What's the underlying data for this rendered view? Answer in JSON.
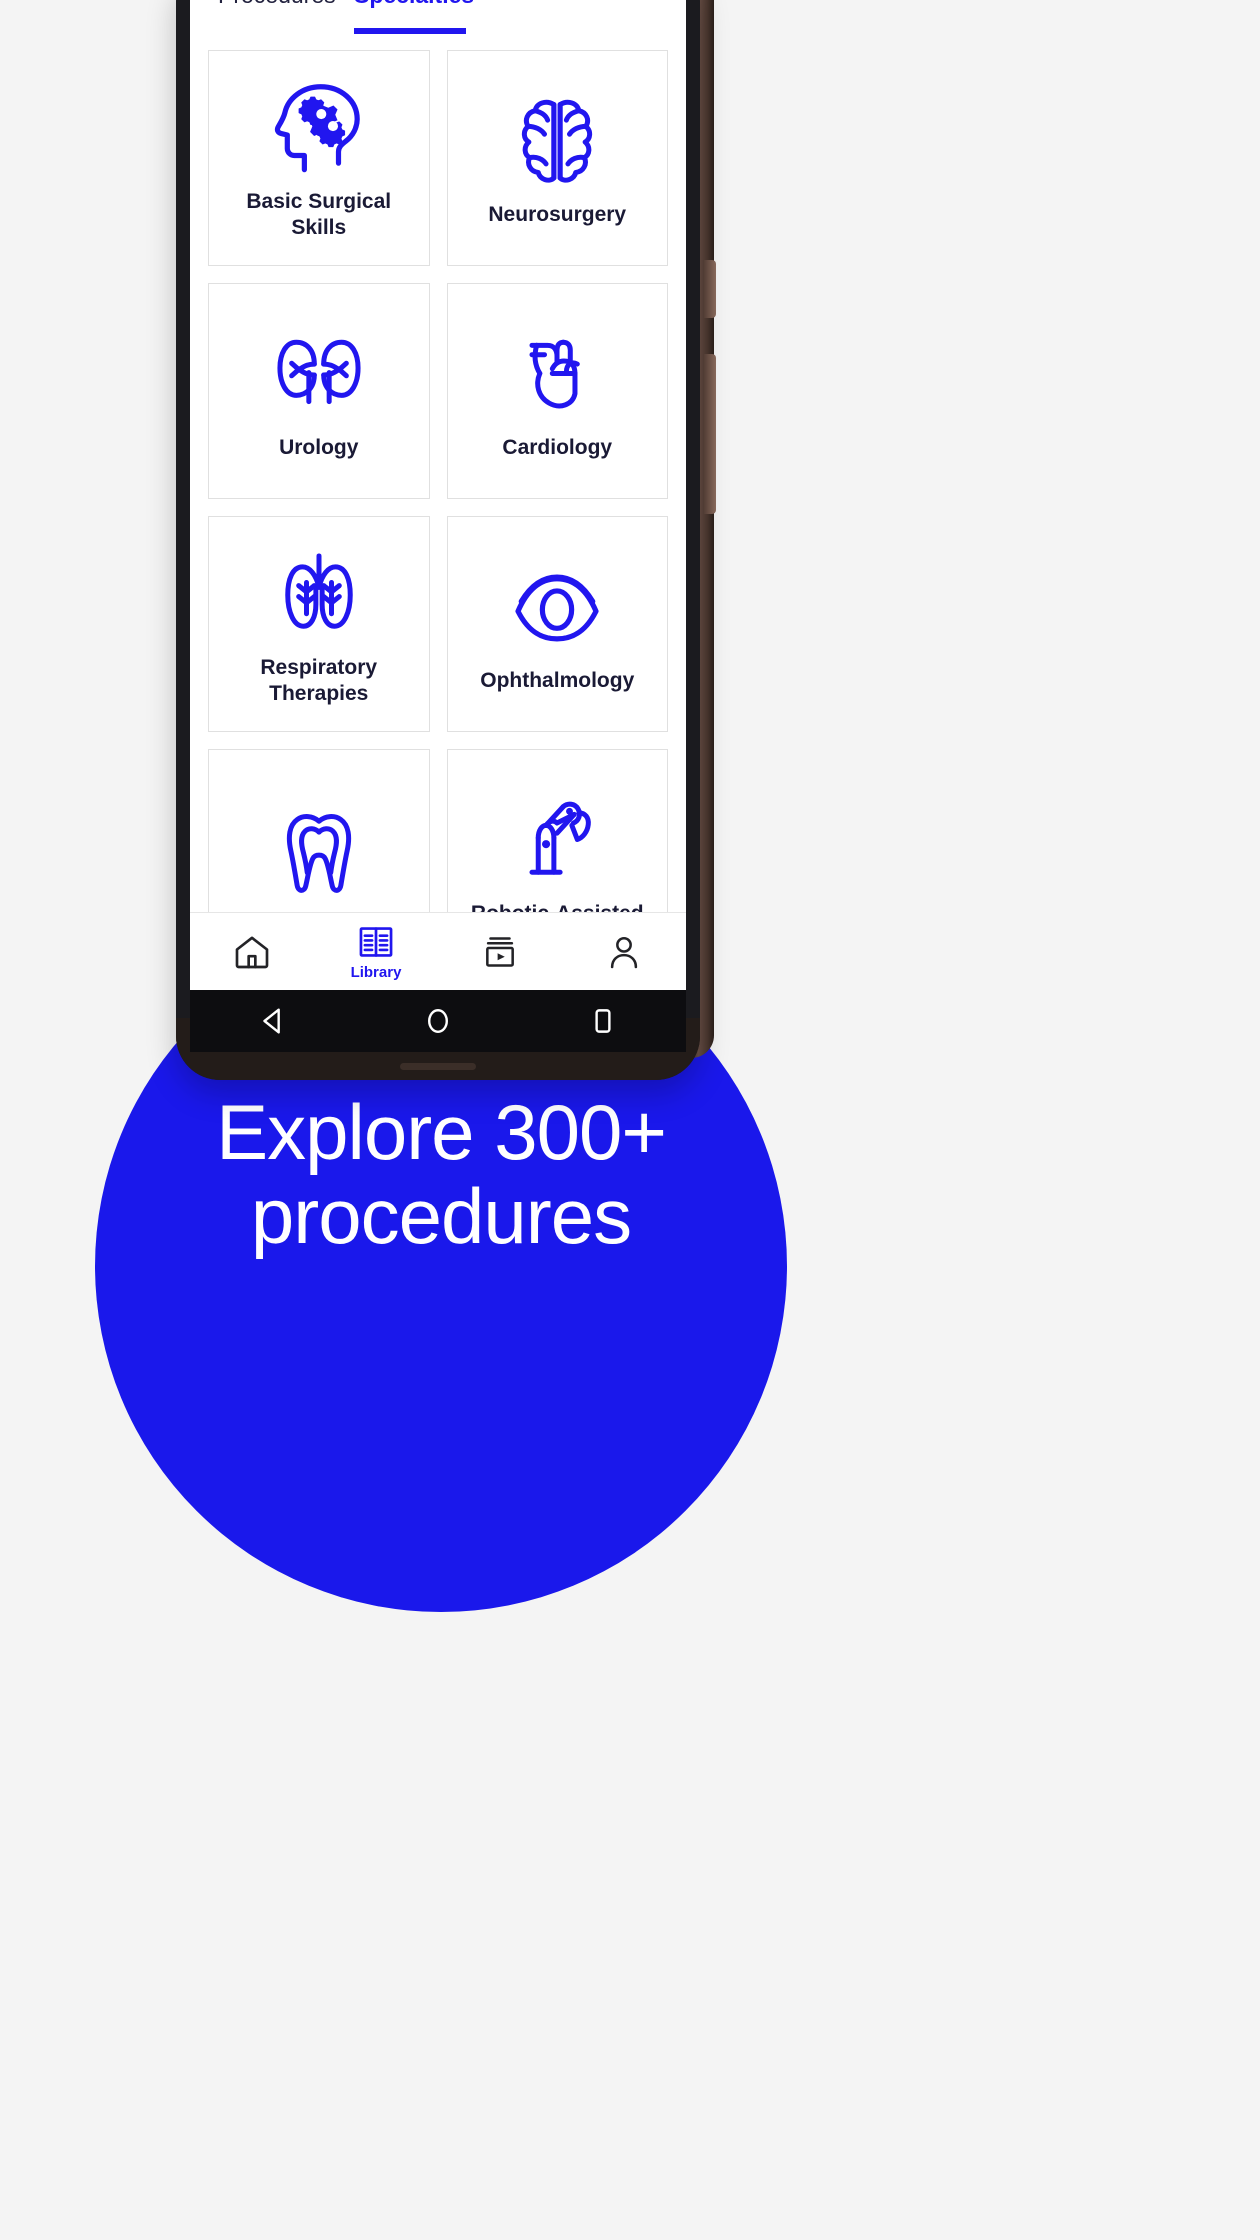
{
  "app": {
    "tabs": [
      {
        "label": "Procedures",
        "active": false
      },
      {
        "label": "Specialties",
        "active": true
      }
    ],
    "specialties": [
      {
        "label": "Basic Surgical Skills",
        "icon": "head-gears-icon"
      },
      {
        "label": "Neurosurgery",
        "icon": "brain-icon"
      },
      {
        "label": "Urology",
        "icon": "kidneys-icon"
      },
      {
        "label": "Cardiology",
        "icon": "heart-icon"
      },
      {
        "label": "Respiratory Therapies",
        "icon": "lungs-icon"
      },
      {
        "label": "Ophthalmology",
        "icon": "eye-icon"
      },
      {
        "label": "",
        "icon": "tooth-icon"
      },
      {
        "label": "Robotic-Assisted",
        "icon": "robotic-arm-icon"
      }
    ],
    "bottom_nav": [
      {
        "label": "",
        "icon": "home-icon",
        "active": false
      },
      {
        "label": "Library",
        "icon": "library-icon",
        "active": true
      },
      {
        "label": "",
        "icon": "video-list-icon",
        "active": false
      },
      {
        "label": "",
        "icon": "person-icon",
        "active": false
      }
    ],
    "system_nav": [
      {
        "icon": "back-triangle-icon"
      },
      {
        "icon": "home-circle-icon"
      },
      {
        "icon": "recents-square-icon"
      }
    ]
  },
  "promo": {
    "line1": "Explore 300+",
    "line2": "procedures"
  },
  "colors": {
    "accent_blue": "#2116ef",
    "promo_circle": "#1a18eb",
    "label_navy": "#1a1a35",
    "page_bg": "#f4f4f4"
  }
}
